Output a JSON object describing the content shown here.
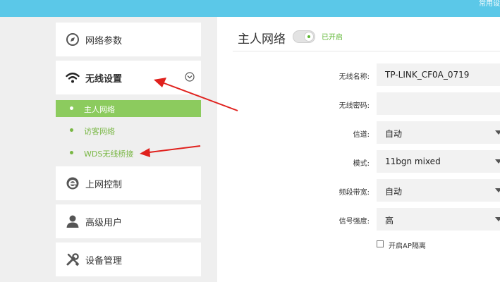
{
  "topbar": {
    "link": "常用设"
  },
  "sidebar": {
    "items": [
      {
        "label": "网络参数",
        "icon": "compass-icon"
      },
      {
        "label": "无线设置",
        "icon": "wifi-icon",
        "expanded": true
      },
      {
        "label": "上网控制",
        "icon": "internet-explorer-icon"
      },
      {
        "label": "高级用户",
        "icon": "user-icon"
      },
      {
        "label": "设备管理",
        "icon": "tools-icon"
      }
    ],
    "subitems": [
      {
        "label": "主人网络",
        "active": true
      },
      {
        "label": "访客网络"
      },
      {
        "label": "WDS无线桥接"
      }
    ]
  },
  "main": {
    "title": "主人网络",
    "toggle_status": "已开启",
    "form": {
      "ssid": {
        "label": "无线名称:",
        "value": "TP-LINK_CF0A_0719"
      },
      "password": {
        "label": "无线密码:",
        "value": ""
      },
      "channel": {
        "label": "信道:",
        "value": "自动"
      },
      "mode": {
        "label": "模式:",
        "value": "11bgn mixed"
      },
      "bandwidth": {
        "label": "频段带宽:",
        "value": "自动"
      },
      "signal": {
        "label": "信号强度:",
        "value": "高"
      }
    },
    "ap_isolation": {
      "label": "开启AP隔离",
      "checked": false
    }
  },
  "colors": {
    "topbar": "#5bc8e8",
    "sidebar_bg": "#efefef",
    "active_green": "#8ccb5e",
    "sub_text_green": "#79b744",
    "status_green": "#5cb531",
    "annotation_red": "#e0211d"
  }
}
